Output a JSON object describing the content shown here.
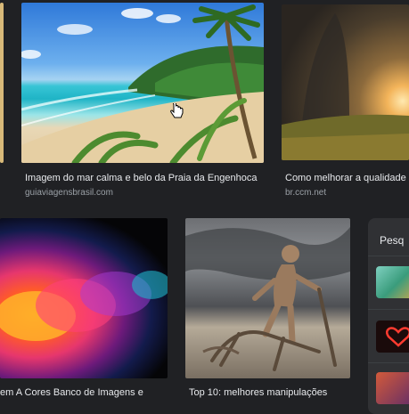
{
  "results": [
    {
      "title": "Imagem do mar calma e belo da Praia da Engenhoca",
      "source": "guiaviagensbrasil.com"
    },
    {
      "title": "Como melhorar a qualidade",
      "source": "br.ccm.net"
    },
    {
      "title": "em A Cores Banco de Imagens e",
      "source": ""
    },
    {
      "title": "Top 10: melhores manipulações",
      "source": ""
    }
  ],
  "side_panel": {
    "title": "Pesq"
  },
  "icons": {
    "cursor": "hand-pointer-icon",
    "heart": "heart-icon"
  },
  "colors": {
    "background": "#202124",
    "title_text": "#e8eaed",
    "source_text": "#9aa0a6",
    "panel": "#303134"
  }
}
